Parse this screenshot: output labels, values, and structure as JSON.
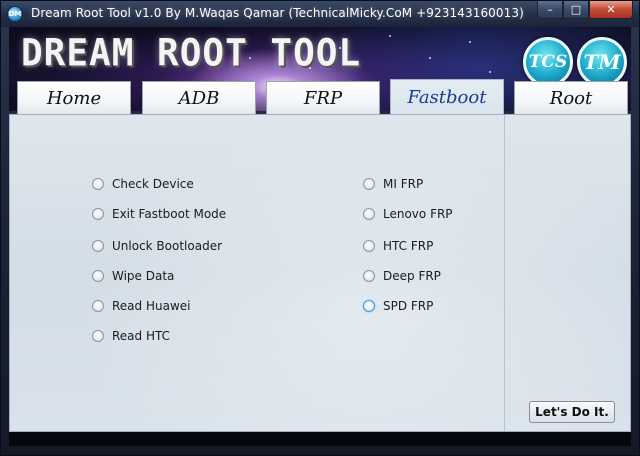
{
  "window": {
    "title": "Dream Root Tool v1.0 By M.Waqas Qamar (TechnicalMicky.CoM +923143160013)",
    "icon_label": "DM",
    "controls": {
      "minimize": "–",
      "maximize": "□",
      "close": "✕"
    }
  },
  "banner": {
    "title": "DREAM ROOT TOOL",
    "badge_left": "TCS",
    "badge_right": "TM"
  },
  "tabs": [
    {
      "label": "Home",
      "active": false
    },
    {
      "label": "ADB",
      "active": false
    },
    {
      "label": "FRP",
      "active": false
    },
    {
      "label": "Fastboot",
      "active": true
    },
    {
      "label": "Root",
      "active": false
    }
  ],
  "options_left": [
    "Check Device",
    "Exit Fastboot Mode",
    "Unlock Bootloader",
    "Wipe Data",
    "Read Huawei",
    "Read HTC"
  ],
  "options_right": [
    "MI FRP",
    "Lenovo FRP",
    "HTC FRP",
    "Deep FRP",
    "SPD FRP"
  ],
  "action_button": "Let's Do It.",
  "colors": {
    "active_tab_text": "#1a3a9a",
    "panel_bg": "#d9e2ea",
    "close_button": "#c8503a"
  }
}
